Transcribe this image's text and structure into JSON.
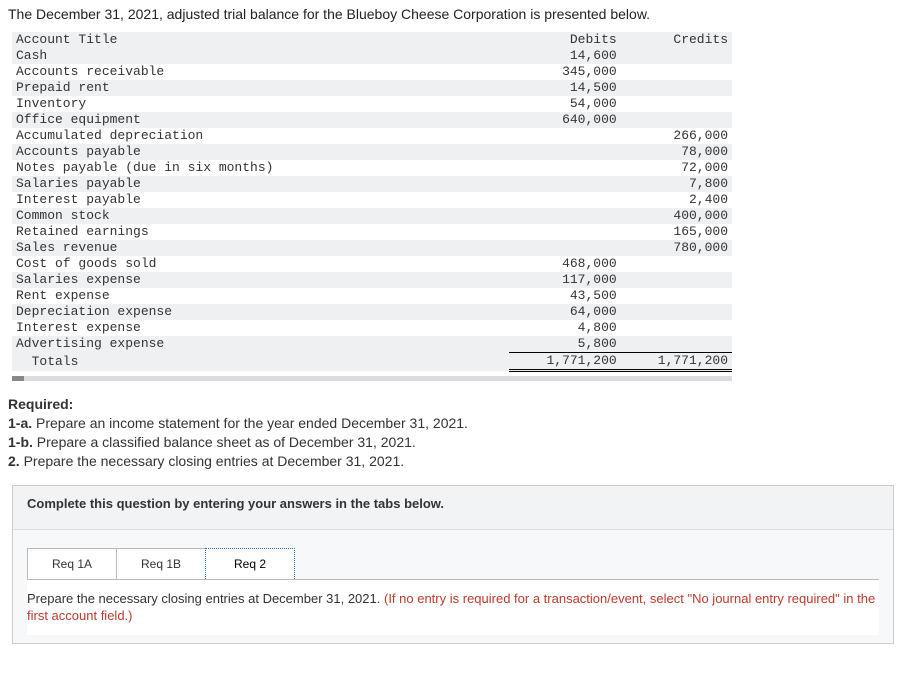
{
  "intro": "The December 31, 2021, adjusted trial balance for the Blueboy Cheese Corporation is presented below.",
  "tb_headers": {
    "account": "Account Title",
    "debits": "Debits",
    "credits": "Credits"
  },
  "rows": [
    {
      "a": "Cash",
      "d": "14,600",
      "c": ""
    },
    {
      "a": "Accounts receivable",
      "d": "345,000",
      "c": ""
    },
    {
      "a": "Prepaid rent",
      "d": "14,500",
      "c": ""
    },
    {
      "a": "Inventory",
      "d": "54,000",
      "c": ""
    },
    {
      "a": "Office equipment",
      "d": "640,000",
      "c": ""
    },
    {
      "a": "Accumulated depreciation",
      "d": "",
      "c": "266,000"
    },
    {
      "a": "Accounts payable",
      "d": "",
      "c": "78,000"
    },
    {
      "a": "Notes payable (due in six months)",
      "d": "",
      "c": "72,000"
    },
    {
      "a": "Salaries payable",
      "d": "",
      "c": "7,800"
    },
    {
      "a": "Interest payable",
      "d": "",
      "c": "2,400"
    },
    {
      "a": "Common stock",
      "d": "",
      "c": "400,000"
    },
    {
      "a": "Retained earnings",
      "d": "",
      "c": "165,000"
    },
    {
      "a": "Sales revenue",
      "d": "",
      "c": "780,000"
    },
    {
      "a": "Cost of goods sold",
      "d": "468,000",
      "c": ""
    },
    {
      "a": "Salaries expense",
      "d": "117,000",
      "c": ""
    },
    {
      "a": "Rent expense",
      "d": "43,500",
      "c": ""
    },
    {
      "a": "Depreciation expense",
      "d": "64,000",
      "c": ""
    },
    {
      "a": "Interest expense",
      "d": "4,800",
      "c": ""
    },
    {
      "a": "Advertising expense",
      "d": "5,800",
      "c": ""
    }
  ],
  "totals": {
    "label": "  Totals",
    "d": "1,771,200",
    "c": "1,771,200"
  },
  "required": {
    "heading": "Required:",
    "r1a_num": "1-a.",
    "r1a_txt": " Prepare an income statement for the year ended December 31, 2021.",
    "r1b_num": "1-b.",
    "r1b_txt": " Prepare a classified balance sheet as of December 31, 2021.",
    "r2_num": "2.",
    "r2_txt": " Prepare the necessary closing entries at December 31, 2021."
  },
  "complete_text": "Complete this question by entering your answers in the tabs below.",
  "tabs": {
    "t1": "Req 1A",
    "t2": "Req 1B",
    "t3": "Req 2"
  },
  "active_instr": {
    "black": "Prepare the necessary closing entries at December 31, 2021. ",
    "red": "(If no entry is required for a transaction/event, select \"No journal entry required\" in the first account field.)"
  }
}
